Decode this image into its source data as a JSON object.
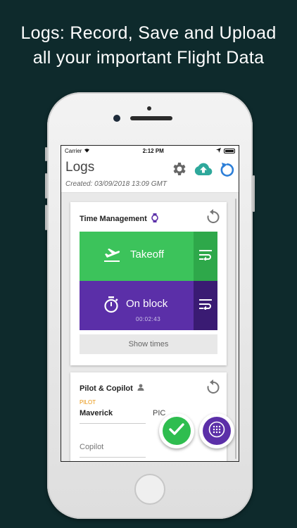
{
  "headline": {
    "line1": "Logs: Record, Save and Upload",
    "line2": "all your important Flight Data"
  },
  "statusbar": {
    "carrier": "Carrier",
    "time": "2:12 PM"
  },
  "appbar": {
    "title": "Logs",
    "created": "Created: 03/09/2018 13:09 GMT",
    "icons": [
      "gear-icon",
      "cloud-upload-icon",
      "refresh-icon"
    ]
  },
  "time_management": {
    "title": "Time Management",
    "takeoff_label": "Takeoff",
    "onblock_label": "On block",
    "onblock_elapsed": "00:02:43",
    "show_times_label": "Show times"
  },
  "crew": {
    "title": "Pilot & Copilot",
    "pilot_label": "PILOT",
    "pilot_name": "Maverick",
    "pilot_role": "PIC",
    "copilot_placeholder": "Copilot"
  },
  "colors": {
    "background": "#0e2a2c",
    "takeoff_green": "#3cc35b",
    "onblock_purple": "#5b2fa8",
    "accent_teal": "#2ea89b",
    "accent_blue": "#2d7fd8",
    "label_orange": "#e8930c"
  }
}
